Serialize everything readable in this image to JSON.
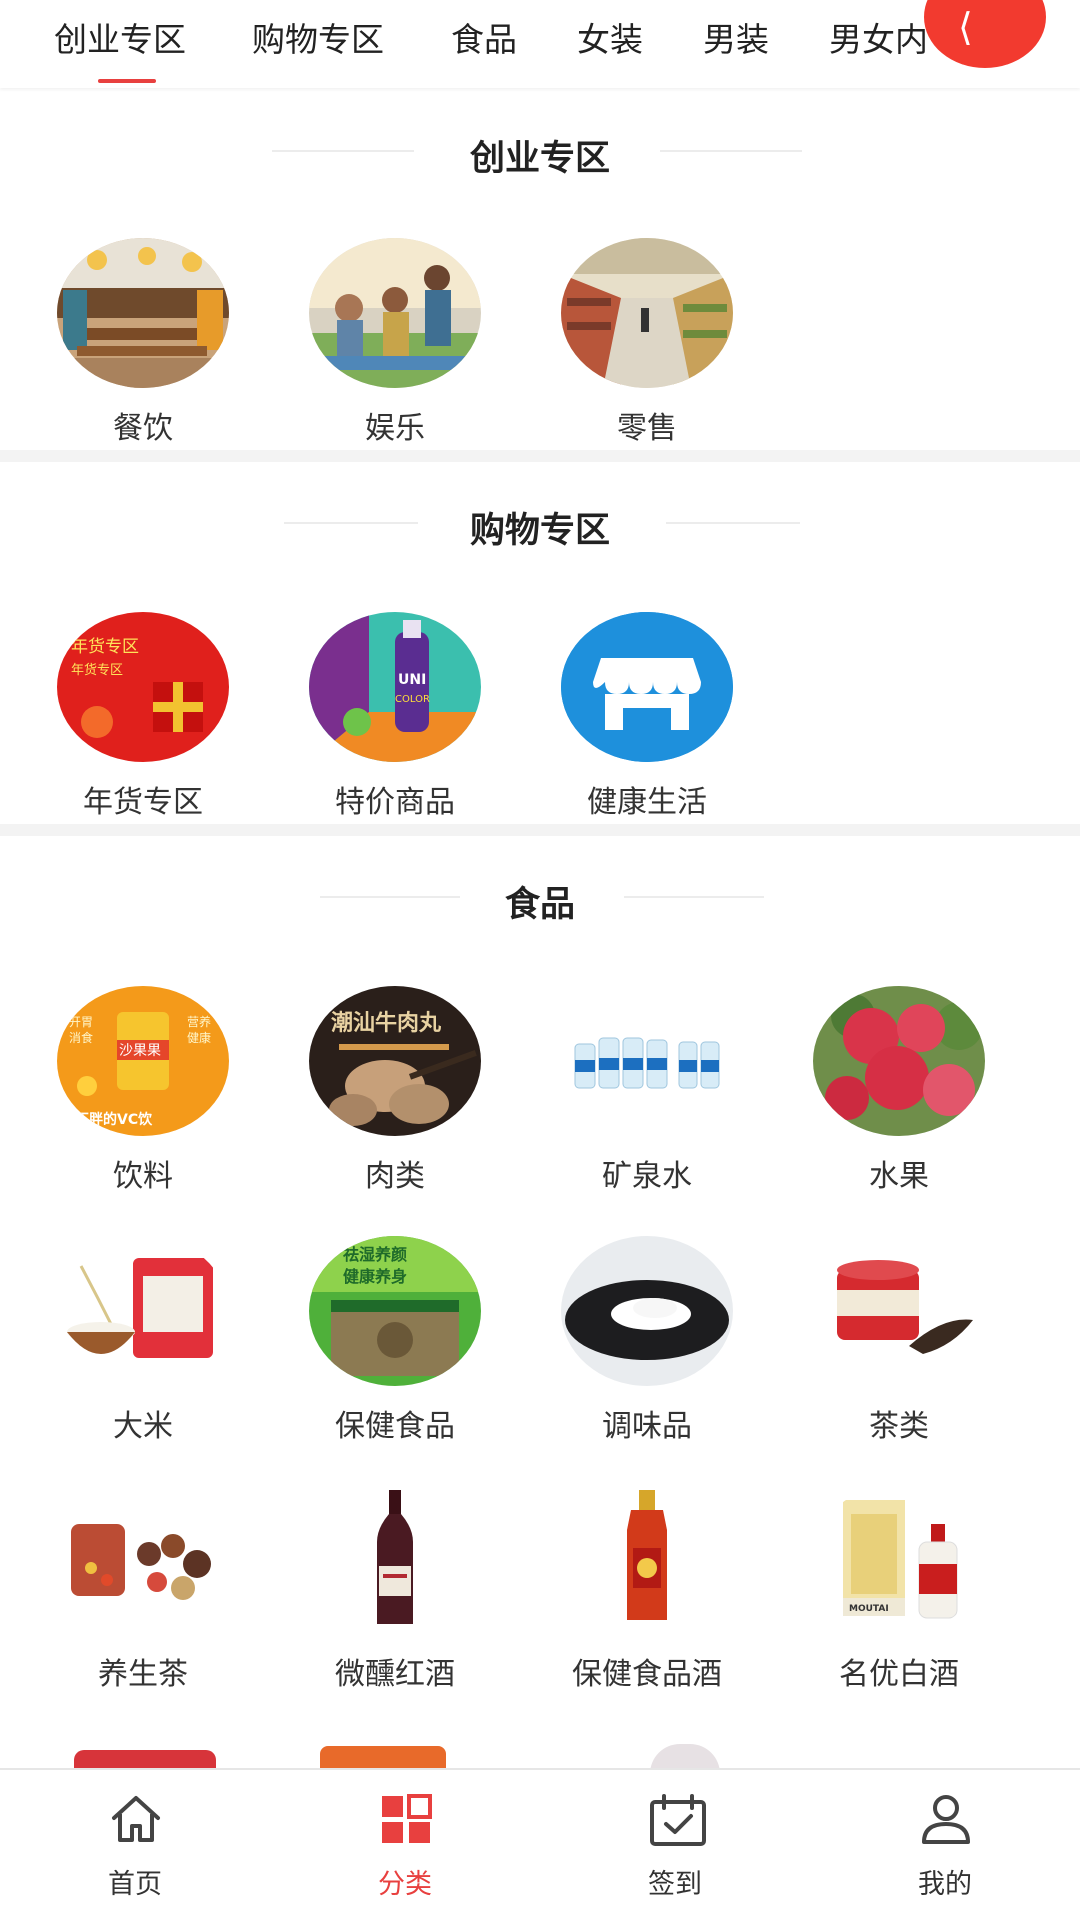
{
  "tabs": [
    {
      "label": "创业专区",
      "active": true
    },
    {
      "label": "购物专区"
    },
    {
      "label": "食品"
    },
    {
      "label": "女装"
    },
    {
      "label": "男装"
    },
    {
      "label": "男女内"
    }
  ],
  "accent_color": "#e8403f",
  "sections": [
    {
      "title": "创业专区",
      "items": [
        {
          "label": "餐饮",
          "icon": "restaurant-photo"
        },
        {
          "label": "娱乐",
          "icon": "entertainment-photo"
        },
        {
          "label": "零售",
          "icon": "retail-store-photo"
        }
      ]
    },
    {
      "title": "购物专区",
      "items": [
        {
          "label": "年货专区",
          "icon": "new-year-goods-photo",
          "image_text": [
            "年货专区",
            "年货专区"
          ]
        },
        {
          "label": "特价商品",
          "icon": "special-offer-photo",
          "image_text": [
            "UNI",
            "COLOR"
          ]
        },
        {
          "label": "健康生活",
          "icon": "storefront-icon"
        }
      ]
    },
    {
      "title": "食品",
      "items": [
        {
          "label": "饮料",
          "icon": "beverage-photo",
          "image_text": [
            "沙果果",
            "不胖的VC饮",
            "开胃",
            "消食",
            "营养",
            "健康"
          ]
        },
        {
          "label": "肉类",
          "icon": "meatball-photo",
          "image_text": [
            "潮汕牛肉丸"
          ]
        },
        {
          "label": "矿泉水",
          "icon": "mineral-water-photo"
        },
        {
          "label": "水果",
          "icon": "apple-photo"
        },
        {
          "label": "大米",
          "icon": "rice-photo"
        },
        {
          "label": "保健食品",
          "icon": "health-food-photo",
          "image_text": [
            "祛湿养颜",
            "健康养身"
          ]
        },
        {
          "label": "调味品",
          "icon": "seasoning-photo"
        },
        {
          "label": "茶类",
          "icon": "tea-photo"
        },
        {
          "label": "养生茶",
          "icon": "herbal-tea-photo"
        },
        {
          "label": "微醺红酒",
          "icon": "red-wine-photo"
        },
        {
          "label": "保健食品酒",
          "icon": "health-liquor-photo"
        },
        {
          "label": "名优白酒",
          "icon": "baijiu-photo",
          "image_text": [
            "MOUTAI"
          ]
        }
      ]
    }
  ],
  "bottom_nav": [
    {
      "label": "首页",
      "icon": "home-icon"
    },
    {
      "label": "分类",
      "icon": "category-grid-icon",
      "active": true
    },
    {
      "label": "签到",
      "icon": "calendar-check-icon"
    },
    {
      "label": "我的",
      "icon": "user-icon"
    }
  ]
}
